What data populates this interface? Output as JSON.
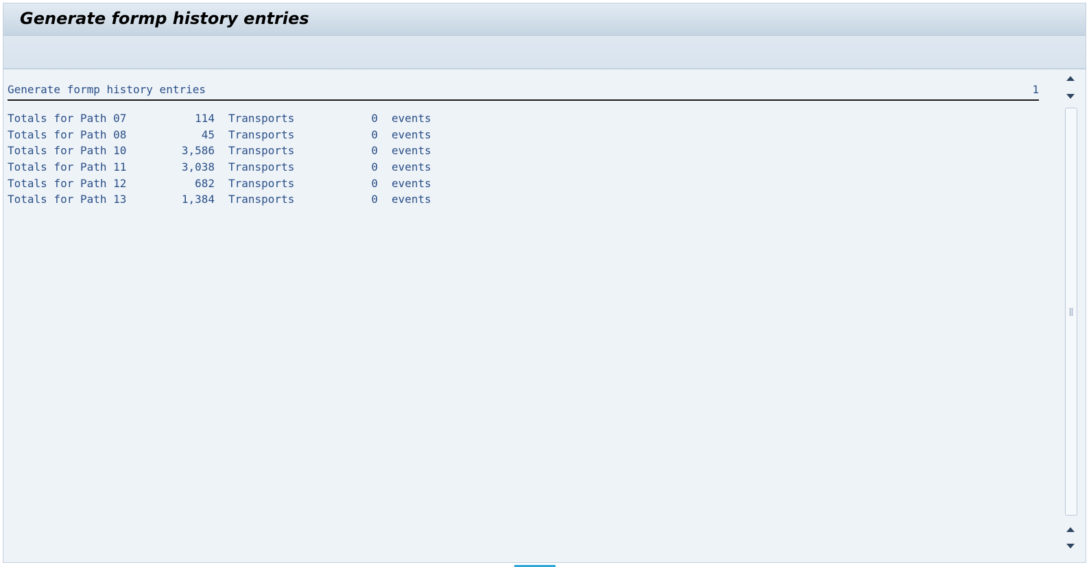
{
  "window": {
    "title": "Generate formp history entries"
  },
  "list": {
    "header_title": "Generate formp history entries",
    "page_number": "1",
    "rows": [
      {
        "label": "Totals for Path 07",
        "count": "114",
        "transports_label": "Transports",
        "events": "0",
        "events_label": "events"
      },
      {
        "label": "Totals for Path 08",
        "count": "45",
        "transports_label": "Transports",
        "events": "0",
        "events_label": "events"
      },
      {
        "label": "Totals for Path 10",
        "count": "3,586",
        "transports_label": "Transports",
        "events": "0",
        "events_label": "events"
      },
      {
        "label": "Totals for Path 11",
        "count": "3,038",
        "transports_label": "Transports",
        "events": "0",
        "events_label": "events"
      },
      {
        "label": "Totals for Path 12",
        "count": "682",
        "transports_label": "Transports",
        "events": "0",
        "events_label": "events"
      },
      {
        "label": "Totals for Path 13",
        "count": "1,384",
        "transports_label": "Transports",
        "events": "0",
        "events_label": "events"
      }
    ]
  },
  "icons": {
    "scroll_up": "triangle-up-icon",
    "scroll_down": "triangle-down-icon",
    "grip": "grip-dots-icon"
  },
  "colors": {
    "text_blue": "#2a4f87",
    "background": "#eef3f8",
    "header_rule": "#1a1a1a",
    "status_accent": "#2aa6d8"
  }
}
